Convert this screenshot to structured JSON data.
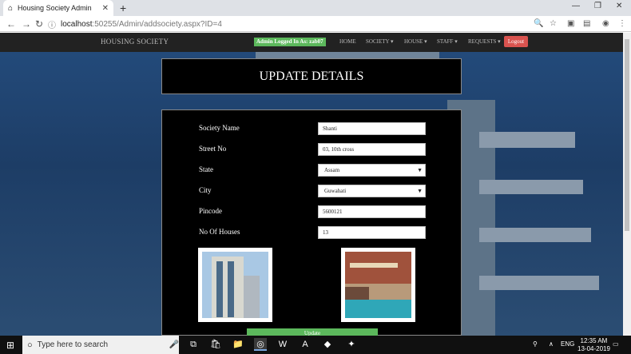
{
  "browser": {
    "tab_title": "Housing Society Admin",
    "tab_close": "✕",
    "new_tab": "+",
    "url_host": "localhost",
    "url_path": ":50255/Admin/addsociety.aspx?ID=4"
  },
  "site_nav": {
    "brand": "HOUSING SOCIETY",
    "logged_in_badge": "Admin Logged In As: zab07",
    "links": [
      "HOME",
      "SOCIETY ▾",
      "HOUSE ▾",
      "STAFF ▾",
      "REQUESTS ▾"
    ],
    "logout": "Logout"
  },
  "header": {
    "title": "UPDATE DETAILS"
  },
  "form": {
    "society_name_label": "Society Name",
    "society_name_value": "Shanti",
    "street_no_label": "Street No",
    "street_no_value": "03, 10th cross",
    "state_label": "State",
    "state_value": "Assam",
    "city_label": "City",
    "city_value": "Guwahati",
    "pincode_label": "Pincode",
    "pincode_value": "5600121",
    "houses_label": "No Of Houses",
    "houses_value": "13",
    "update_button": "Update"
  },
  "taskbar": {
    "search_placeholder": "Type here to search",
    "lang": "ENG",
    "time": "12:35 AM",
    "date": "13-04-2019"
  }
}
